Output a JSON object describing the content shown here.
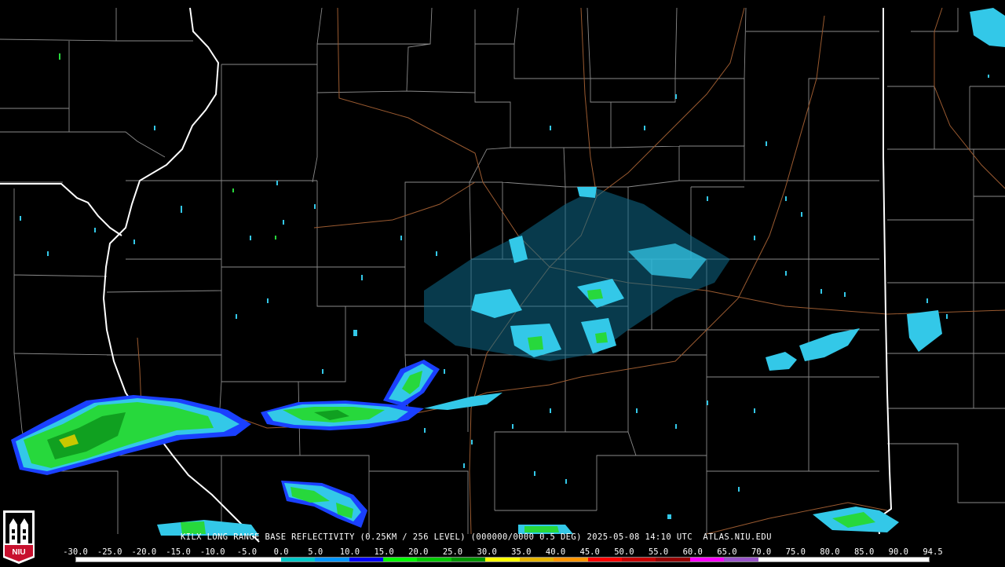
{
  "product_caption": "KILX LONG RANGE BASE REFLECTIVITY (0.25KM / 256 LEVEL) (000000/0000 0.5 DEG) 2025-05-08 14:10 UTC  ATLAS.NIU.EDU",
  "logo": {
    "text": "NIU",
    "color": "#c8102e"
  },
  "legend": {
    "labels": [
      "-30.0",
      "-25.0",
      "-20.0",
      "-15.0",
      "-10.0",
      "-5.0",
      "0.0",
      "5.0",
      "10.0",
      "15.0",
      "20.0",
      "25.0",
      "30.0",
      "35.0",
      "40.0",
      "45.0",
      "50.0",
      "55.0",
      "60.0",
      "65.0",
      "70.0",
      "75.0",
      "80.0",
      "85.0",
      "90.0",
      "94.5"
    ],
    "colors": [
      "#ffffff",
      "#ffffff",
      "#ffffff",
      "#ffffff",
      "#ffffff",
      "#ffffff",
      "#00c8c8",
      "#0096ff",
      "#0000ff",
      "#00ff00",
      "#00c800",
      "#009600",
      "#ffff00",
      "#e6b400",
      "#ff9600",
      "#ff0000",
      "#c80000",
      "#960000",
      "#ff00ff",
      "#9955c9",
      "#ffffff",
      "#ffffff",
      "#ffffff",
      "#ffffff",
      "#ffffff"
    ]
  },
  "map_colors": {
    "background": "#000000",
    "county_lines": "#8a8a8a",
    "state_lines": "#ffffff",
    "highways": "#9a5a30",
    "echo_light": "#33c8e8",
    "echo_blue": "#1a40ff",
    "echo_green": "#27d83c",
    "echo_dark_green": "#10a020",
    "echo_yellow": "#c8c800"
  }
}
